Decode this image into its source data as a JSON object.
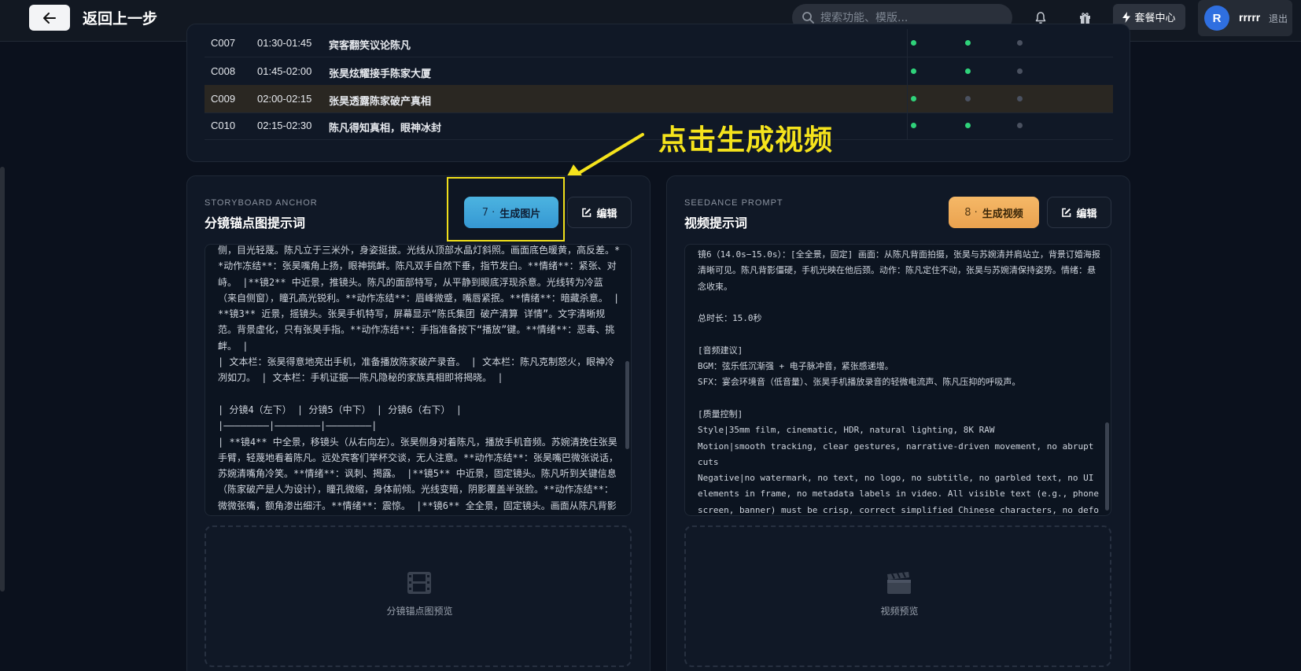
{
  "header": {
    "back_label": "返回上一步",
    "search_placeholder": "搜索功能、模版...",
    "package_label": "套餐中心",
    "avatar_letter": "R",
    "username": "rrrrr",
    "logout_label": "退出"
  },
  "table": {
    "rows": [
      {
        "id": "C007",
        "time": "01:30-01:45",
        "desc": "宾客翻笑议论陈凡",
        "s1": true,
        "s2": true,
        "s3": false
      },
      {
        "id": "C008",
        "time": "01:45-02:00",
        "desc": "张昊炫耀接手陈家大厦",
        "s1": true,
        "s2": true,
        "s3": false
      },
      {
        "id": "C009",
        "time": "02:00-02:15",
        "desc": "张昊透露陈家破产真相",
        "s1": true,
        "s2": false,
        "s3": false
      },
      {
        "id": "C010",
        "time": "02:15-02:30",
        "desc": "陈凡得知真相，眼神冰封",
        "s1": true,
        "s2": true,
        "s3": false
      }
    ]
  },
  "annotation": {
    "text": "点击生成视频"
  },
  "storyboard": {
    "eyebrow": "STORYBOARD ANCHOR",
    "title": "分镜锚点图提示词",
    "gen_num": "7 ·",
    "gen_label": "生成图片",
    "edit_label": "编辑",
    "content": "侧，目光轻蔑。陈凡立于三米外，身姿挺拔。光线从顶部水晶灯斜照。画面底色暖黄，高反差。**动作冻结**：张昊嘴角上扬，眼神挑衅。陈凡双手自然下垂，指节发白。**情绪**：紧张、对峙。 |**镜2** 中近景，推镜头。陈凡的面部特写，从平静到眼底浮现杀意。光线转为冷蓝（来自侧窗），瞳孔高光锐利。**动作冻结**：眉峰微蹙，嘴唇紧抿。**情绪**：暗藏杀意。 |**镜3** 近景，摇镜头。张昊手机特写，屏幕显示“陈氏集团 破产清算 详情”。文字清晰规范。背景虚化，只有张昊手指。**动作冻结**：手指准备按下“播放”键。**情绪**：恶毒、挑衅。 |\n| 文本栏：张昊得意地亮出手机，准备播放陈家破产录音。 | 文本栏：陈凡克制怒火，眼神冷冽如刀。 | 文本栏：手机证据——陈凡隐秘的家族真相即将揭晓。 |\n\n| 分镜4（左下） | 分镜5（中下） | 分镜6（右下） |\n|————————|————————|————————|\n| **镜4** 中全景，移镜头（从右向左）。张昊侧身对着陈凡，播放手机音频。苏婉清挽住张昊手臂，轻蔑地看着陈凡。远处宾客们举杯交谈，无人注意。**动作冻结**：张昊嘴巴微张说话，苏婉清嘴角冷笑。**情绪**：讽刺、揭露。 |**镜5** 中近景，固定镜头。陈凡听到关键信息（陈家破产是人为设计），瞳孔微缩，身体前倾。光线变暗，阴影覆盖半张脸。**动作冻结**：微微张嘴，额角渗出细汗。**情绪**：震惊。 |**镜6** 全全景，固定镜头。画面从陈凡背影",
    "preview_label": "分镜锚点图预览"
  },
  "video": {
    "eyebrow": "SEEDANCE PROMPT",
    "title": "视频提示词",
    "gen_num": "8 ·",
    "gen_label": "生成视频",
    "edit_label": "编辑",
    "content": "镜6（14.0s−15.0s）：[全全景，固定] 画面：从陈凡背面拍摄，张昊与苏婉清并肩站立，背景订婚海报清晰可见。陈凡背影僵硬，手机光映在他后颈。动作：陈凡定住不动，张昊与苏婉清保持姿势。情绪：悬念收束。\n\n总时长：15.0秒\n\n[音频建议]\nBGM：弦乐低沉渐强 + 电子脉冲音，紧张感递增。\nSFX：宴会环境音（低音量）、张昊手机播放录音的轻微电流声、陈凡压抑的呼吸声。\n\n[质量控制]\nStyle|35mm film, cinematic, HDR, natural lighting, 8K RAW\nMotion|smooth tracking, clear gestures, narrative-driven movement, no abrupt cuts\nNegative|no watermark, no text, no logo, no subtitle, no garbled text, no UI elements in frame, no metadata labels in video. All visible text (e.g., phone screen, banner) must be crisp, correct simplified Chinese characters, no deformation.",
    "preview_label": "视频预览"
  },
  "colors": {
    "accent_blue": "#4db8f0",
    "accent_orange": "#f0ac5a",
    "status_on": "#2fd27a",
    "annotation": "#f5e31c"
  }
}
